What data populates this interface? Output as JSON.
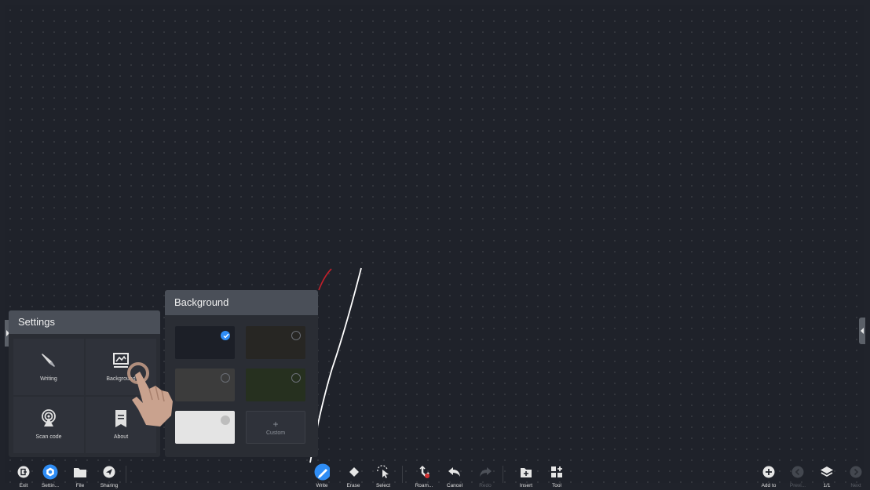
{
  "settings_panel": {
    "title": "Settings",
    "items": [
      {
        "label": "Writing",
        "icon": "pen-icon"
      },
      {
        "label": "Background",
        "icon": "background-image-icon"
      },
      {
        "label": "Scan code",
        "icon": "scan-code-icon"
      },
      {
        "label": "About",
        "icon": "about-icon"
      }
    ]
  },
  "background_panel": {
    "title": "Background",
    "swatches": [
      {
        "color": "#1c1f27",
        "selected": true
      },
      {
        "color": "#272623",
        "selected": false
      },
      {
        "color": "#3c3c3c",
        "selected": false
      },
      {
        "color": "#26301f",
        "selected": false
      },
      {
        "color": "#e4e4e4",
        "selected": false
      }
    ],
    "custom": {
      "plus": "+",
      "label": "Custom"
    }
  },
  "toolbar": {
    "left": [
      {
        "label": "Exit",
        "icon": "exit-icon"
      },
      {
        "label": "Settin...",
        "icon": "settings-icon"
      },
      {
        "label": "File",
        "icon": "folder-icon"
      },
      {
        "label": "Sharing",
        "icon": "share-icon"
      }
    ],
    "center": [
      {
        "label": "Write",
        "icon": "write-icon"
      },
      {
        "label": "Erase",
        "icon": "eraser-icon"
      },
      {
        "label": "Select",
        "icon": "select-icon"
      },
      {
        "label": "Roam...",
        "icon": "roam-icon"
      },
      {
        "label": "Cancel",
        "icon": "undo-icon"
      },
      {
        "label": "Redo",
        "icon": "redo-icon"
      },
      {
        "label": "Insert",
        "icon": "insert-icon"
      },
      {
        "label": "Tool",
        "icon": "tool-icon"
      }
    ],
    "right": [
      {
        "label": "Add to",
        "icon": "add-icon"
      },
      {
        "label": "Previ...",
        "icon": "prev-icon"
      },
      {
        "label": "1/1",
        "icon": "layers-icon"
      },
      {
        "label": "Next",
        "icon": "next-icon"
      }
    ]
  },
  "colors": {
    "accent": "#2f8df5",
    "canvas": "#1f222a",
    "stroke_white": "#ffffff",
    "stroke_red": "#c0202a"
  }
}
